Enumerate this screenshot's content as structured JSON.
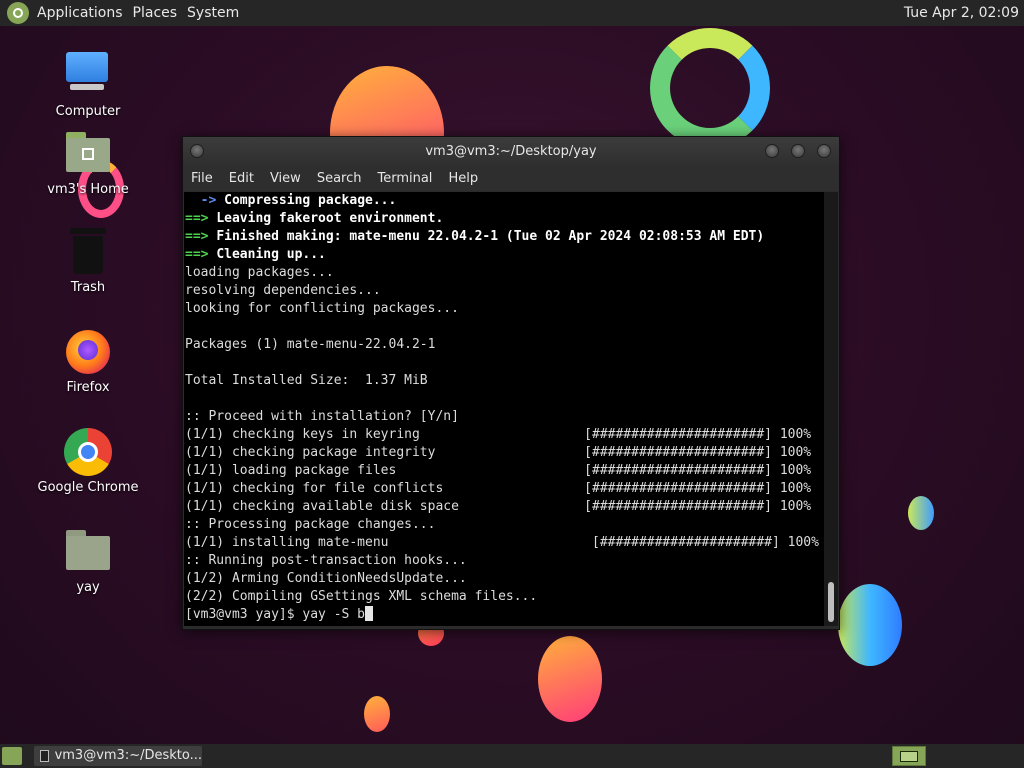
{
  "top_panel": {
    "menus": [
      "Applications",
      "Places",
      "System"
    ],
    "clock": "Tue Apr  2, 02:09"
  },
  "desktop": {
    "icons": [
      {
        "label": "Computer"
      },
      {
        "label": "vm3's Home"
      },
      {
        "label": "Trash"
      },
      {
        "label": "Firefox"
      },
      {
        "label": "Google Chrome"
      },
      {
        "label": "yay"
      }
    ]
  },
  "terminal": {
    "title": "vm3@vm3:~/Desktop/yay",
    "menu": [
      "File",
      "Edit",
      "View",
      "Search",
      "Terminal",
      "Help"
    ],
    "lines": [
      {
        "prefix": "  -> ",
        "text": "Compressing package...",
        "style": "blue"
      },
      {
        "prefix": "==> ",
        "text": "Leaving fakeroot environment.",
        "style": "green"
      },
      {
        "prefix": "==> ",
        "text": "Finished making: mate-menu 22.04.2-1 (Tue 02 Apr 2024 02:08:53 AM EDT)",
        "style": "green"
      },
      {
        "prefix": "==> ",
        "text": "Cleaning up...",
        "style": "green"
      },
      {
        "prefix": "",
        "text": "loading packages...",
        "style": "plain"
      },
      {
        "prefix": "",
        "text": "resolving dependencies...",
        "style": "plain"
      },
      {
        "prefix": "",
        "text": "looking for conflicting packages...",
        "style": "plain"
      },
      {
        "prefix": "",
        "text": "",
        "style": "plain"
      },
      {
        "prefix": "",
        "text": "Packages (1) mate-menu-22.04.2-1",
        "style": "plain"
      },
      {
        "prefix": "",
        "text": "",
        "style": "plain"
      },
      {
        "prefix": "",
        "text": "Total Installed Size:  1.37 MiB",
        "style": "plain"
      },
      {
        "prefix": "",
        "text": "",
        "style": "plain"
      },
      {
        "prefix": "",
        "text": ":: Proceed with installation? [Y/n]",
        "style": "plain"
      },
      {
        "prefix": "",
        "text": "(1/1) checking keys in keyring                     [######################] 100%",
        "style": "plain"
      },
      {
        "prefix": "",
        "text": "(1/1) checking package integrity                   [######################] 100%",
        "style": "plain"
      },
      {
        "prefix": "",
        "text": "(1/1) loading package files                        [######################] 100%",
        "style": "plain"
      },
      {
        "prefix": "",
        "text": "(1/1) checking for file conflicts                  [######################] 100%",
        "style": "plain"
      },
      {
        "prefix": "",
        "text": "(1/1) checking available disk space                [######################] 100%",
        "style": "plain"
      },
      {
        "prefix": "",
        "text": ":: Processing package changes...",
        "style": "plain"
      },
      {
        "prefix": "",
        "text": "(1/1) installing mate-menu                          [######################] 100%",
        "style": "plain"
      },
      {
        "prefix": "",
        "text": ":: Running post-transaction hooks...",
        "style": "plain"
      },
      {
        "prefix": "",
        "text": "(1/2) Arming ConditionNeedsUpdate...",
        "style": "plain"
      },
      {
        "prefix": "",
        "text": "(2/2) Compiling GSettings XML schema files...",
        "style": "plain"
      }
    ],
    "prompt": "[vm3@vm3 yay]$ yay -S b"
  },
  "bottom_panel": {
    "task_label": "vm3@vm3:~/Deskto..."
  }
}
